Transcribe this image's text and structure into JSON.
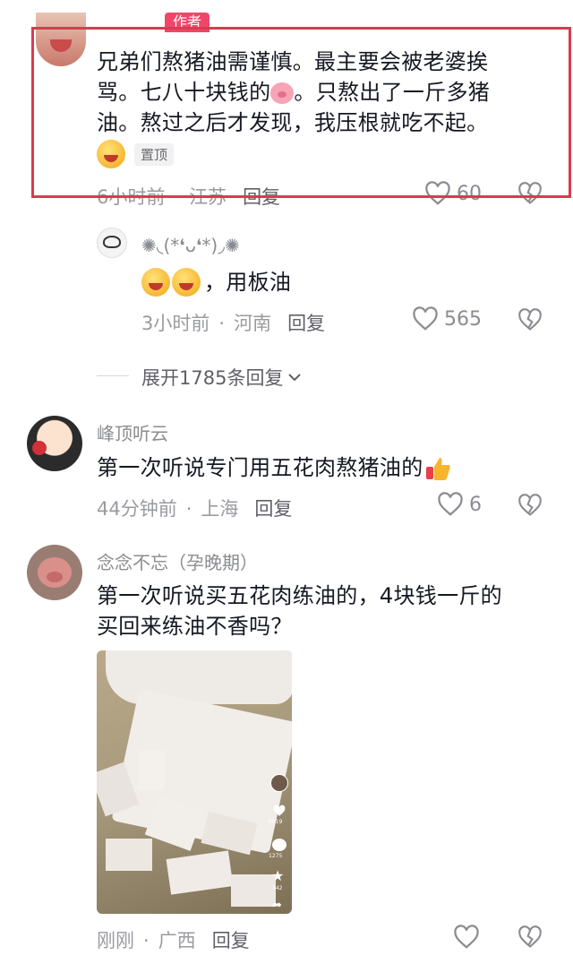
{
  "author_comment": {
    "badge": "作者",
    "text_line1": "兄弟们熬猪油需谨慎。最主要会被老婆挨",
    "text_line2_a": "骂。七八十块钱的",
    "text_line2_b": "。只熬出了一斤多猪",
    "text_line3": "油。熬过之后才发现，我压根就吃不起。",
    "pin_tag": "置顶",
    "time": "6小时前",
    "location": "江苏",
    "reply_label": "回复",
    "likes": "60"
  },
  "reply1": {
    "name": "✺◟(*❛ᴗ❛*)◞✺",
    "text": "，用板油",
    "time": "3小时前",
    "location": "河南",
    "reply_label": "回复",
    "likes": "565"
  },
  "expand": {
    "label": "展开1785条回复"
  },
  "comment2": {
    "name": "峰顶听云",
    "text": "第一次听说专门用五花肉熬猪油的",
    "time": "44分钟前",
    "location": "上海",
    "reply_label": "回复",
    "likes": "6"
  },
  "comment3": {
    "name": "念念不忘（孕晚期）",
    "text_line1": "第一次听说买五花肉练油的，4块钱一斤的",
    "text_line2": "买回来练油不香吗？",
    "time": "刚刚",
    "location": "广西",
    "reply_label": "回复",
    "video_counts": {
      "likes": "6019",
      "comments": "1275",
      "favorites": "342"
    }
  },
  "colors": {
    "highlight_box": "#d93b4f",
    "badge_bg": "#f0466a",
    "text": "#161823",
    "meta": "#9a9ba1"
  }
}
